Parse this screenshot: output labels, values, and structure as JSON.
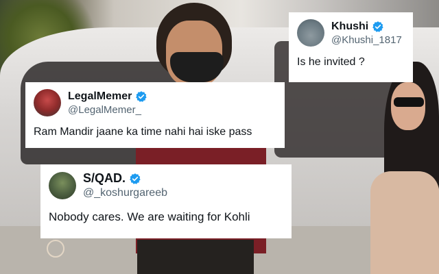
{
  "tweets": [
    {
      "display_name": "Khushi",
      "handle": "@Khushi_1817",
      "text": "Is he invited ?",
      "verified": true
    },
    {
      "display_name": "LegalMemer",
      "handle": "@LegalMemer_",
      "text": "Ram Mandir jaane ka time nahi hai iske pass",
      "verified": true
    },
    {
      "display_name": "S/QAD.",
      "handle": "@_koshurgareeb",
      "text": "Nobody cares. We are waiting for Kohli",
      "verified": true
    }
  ],
  "colors": {
    "card_bg": "#ffffff",
    "verified_blue": "#1d9bf0",
    "name_text": "#0f1419",
    "handle_text": "#536471"
  },
  "icons": [
    "verified-badge-icon",
    "watermark-logo-icon"
  ]
}
